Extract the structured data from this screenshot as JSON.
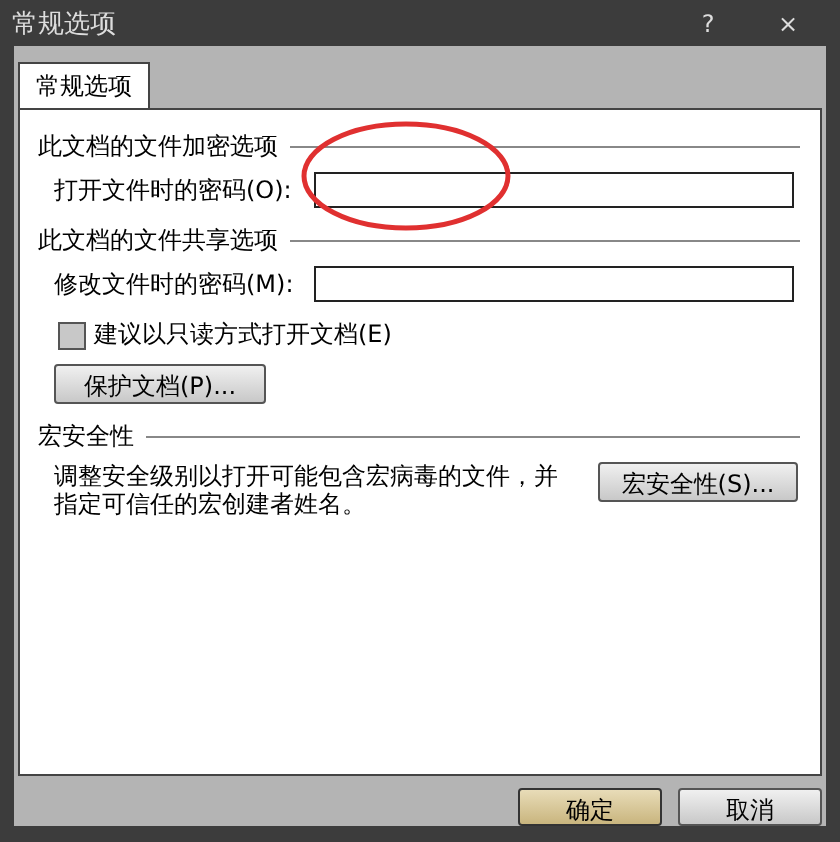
{
  "window": {
    "title": "常规选项",
    "help": "?",
    "close": "×"
  },
  "tabs": [
    {
      "label": "常规选项",
      "selected": true
    }
  ],
  "encryption": {
    "heading": "此文档的文件加密选项",
    "label": "打开文件时的密码(O):"
  },
  "sharing": {
    "heading": "此文档的文件共享选项",
    "label": "修改文件时的密码(M):",
    "readonly": {
      "label": "建议以只读方式打开文档(E)",
      "checked": false
    },
    "protect_button": "保护文档(P)..."
  },
  "macro": {
    "heading": "宏安全性",
    "description": "调整安全级别以打开可能包含宏病毒的文件，并指定可信任的宏创建者姓名。",
    "button": "宏安全性(S)..."
  },
  "buttons": [
    {
      "label": "确定",
      "kind": "default"
    },
    {
      "label": "取消",
      "kind": "normal"
    }
  ]
}
